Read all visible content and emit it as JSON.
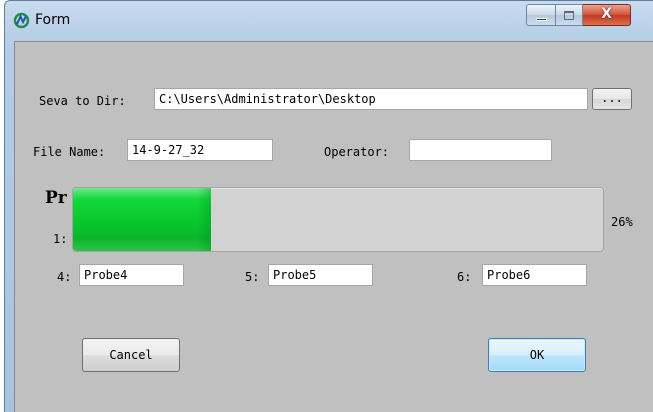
{
  "window": {
    "title": "Form",
    "close_glyph": "X",
    "icons": {
      "app": "app-logo-icon",
      "minimize": "minimize-icon",
      "maximize": "maximize-icon",
      "close": "close-icon"
    }
  },
  "save_dir": {
    "label": "Seva to Dir:",
    "value": "C:\\Users\\Administrator\\Desktop",
    "browse_label": "..."
  },
  "file_name": {
    "label": "File Name:",
    "value": "14-9-27_32"
  },
  "operator": {
    "label": "Operator:",
    "value": ""
  },
  "probes_group": {
    "title_visible": "Pr",
    "row1_label_visible": "1:",
    "probes": [
      {
        "label": "4:",
        "value": "Probe4"
      },
      {
        "label": "5:",
        "value": "Probe5"
      },
      {
        "label": "6:",
        "value": "Probe6"
      }
    ]
  },
  "progress": {
    "percent": 26,
    "text": "26%",
    "fill_color": "#07c72c",
    "track_color": "#d2d2d2"
  },
  "buttons": {
    "cancel_label": "Cancel",
    "ok_label": "OK"
  },
  "colors": {
    "client_background": "#c0c0c0",
    "default_button_border": "#3c7fb1",
    "close_button": "#c23a20"
  }
}
